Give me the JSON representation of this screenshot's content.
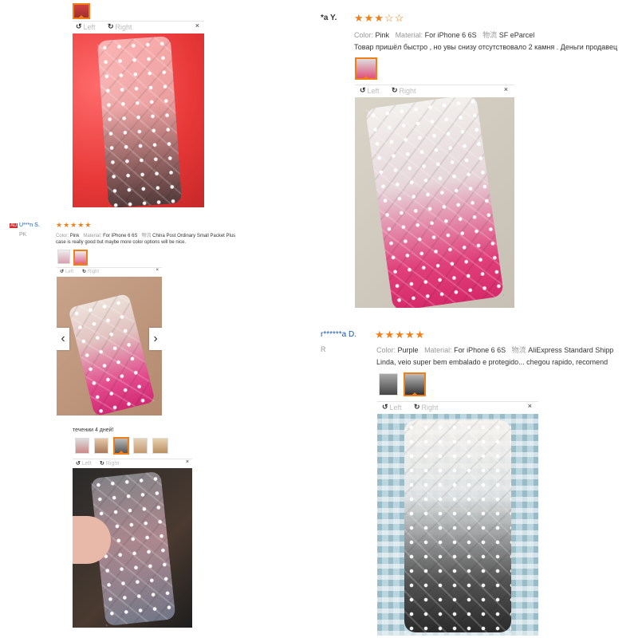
{
  "viewer": {
    "left_label": "Left",
    "right_label": "Right",
    "close_label": "×"
  },
  "review_top_right": {
    "username": "*a Y.",
    "stars": "★★★☆☆",
    "color_label": "Color:",
    "color_value": "Pink",
    "material_label": "Material:",
    "material_value": "For iPhone 6 6S",
    "shipping_label": "物流",
    "shipping_value": "SF eParcel",
    "text": "Товар пришёл быстро , но увы снизу отсутствовало 2 камня . Деньги продавец"
  },
  "review_mid_left": {
    "country_badge": "AU",
    "username": "U***n S.",
    "country_label": "PK",
    "stars": "★★★★★",
    "color_label": "Color:",
    "color_value": "Pink",
    "material_label": "Material:",
    "material_value": "For iPhone 6 6S",
    "shipping_label": "物流",
    "shipping_value": "China Post Ordinary Small Packet Plus",
    "text": "case is really good but maybe more color options will be nice."
  },
  "review_bottom_right": {
    "username": "r******a D.",
    "country_label": "R",
    "stars": "★★★★★",
    "color_label": "Color:",
    "color_value": "Purple",
    "material_label": "Material:",
    "material_value": "For iPhone 6 6S",
    "shipping_label": "物流",
    "shipping_value": "AliExpress Standard Shipp",
    "text": "Linda, veio super bem embalado e protegido... chegou rapido, recomend"
  },
  "review_bottom_left": {
    "text": "течении 4 дней!"
  },
  "colors": {
    "star": "#f07f1a",
    "selected_border": "#f07f1a"
  }
}
